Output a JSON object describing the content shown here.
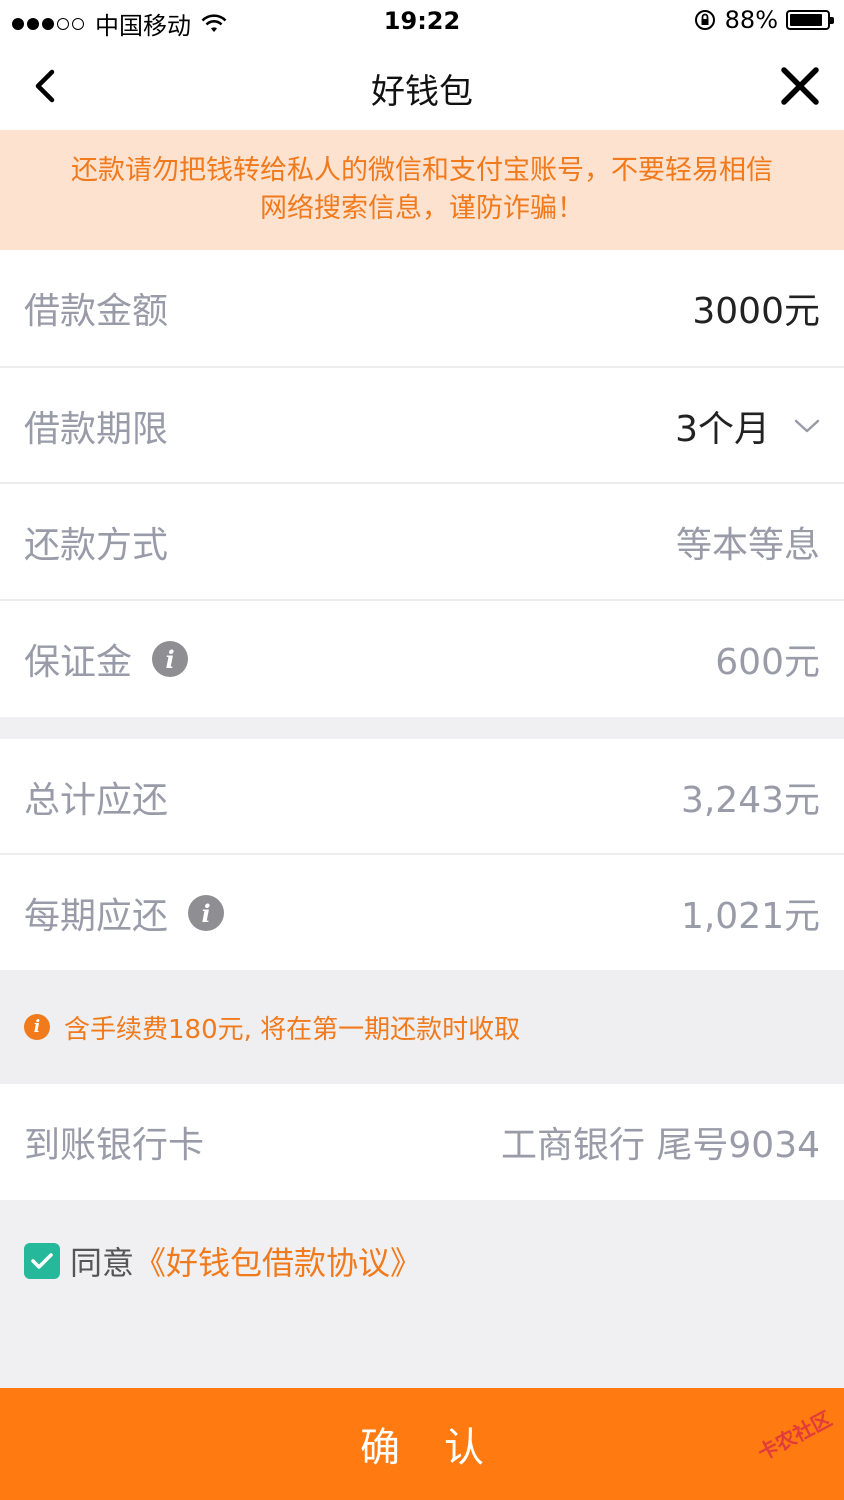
{
  "status_bar": {
    "carrier": "中国移动",
    "time": "19:22",
    "battery": "88%",
    "battery_level": 0.88,
    "signal_bars": 3
  },
  "nav": {
    "title": "好钱包"
  },
  "banner": {
    "text": "还款请勿把钱转给私人的微信和支付宝账号，不要轻易相信网络搜索信息，谨防诈骗！"
  },
  "loan_fields": [
    {
      "label": "借款金额",
      "value": "3000元"
    },
    {
      "label": "借款期限",
      "value": "3个月"
    },
    {
      "label": "还款方式",
      "value": "等本等息"
    },
    {
      "label": "保证金",
      "value": "600元"
    }
  ],
  "repay_fields": [
    {
      "label": "总计应还",
      "value": "3,243元"
    },
    {
      "label": "每期应还",
      "value": "1,021元"
    }
  ],
  "fee_note": "含手续费180元, 将在第一期还款时收取",
  "bank": {
    "label": "到账银行卡",
    "value": "工商银行 尾号9034"
  },
  "agreement": {
    "prefix": "同意",
    "link": "《好钱包借款协议》",
    "checked": true
  },
  "confirm_button": "确认",
  "watermark": "卡农社区",
  "colors": {
    "accent": "#ff7a10",
    "banner_bg": "#fde2d0",
    "check": "#26b89a"
  }
}
